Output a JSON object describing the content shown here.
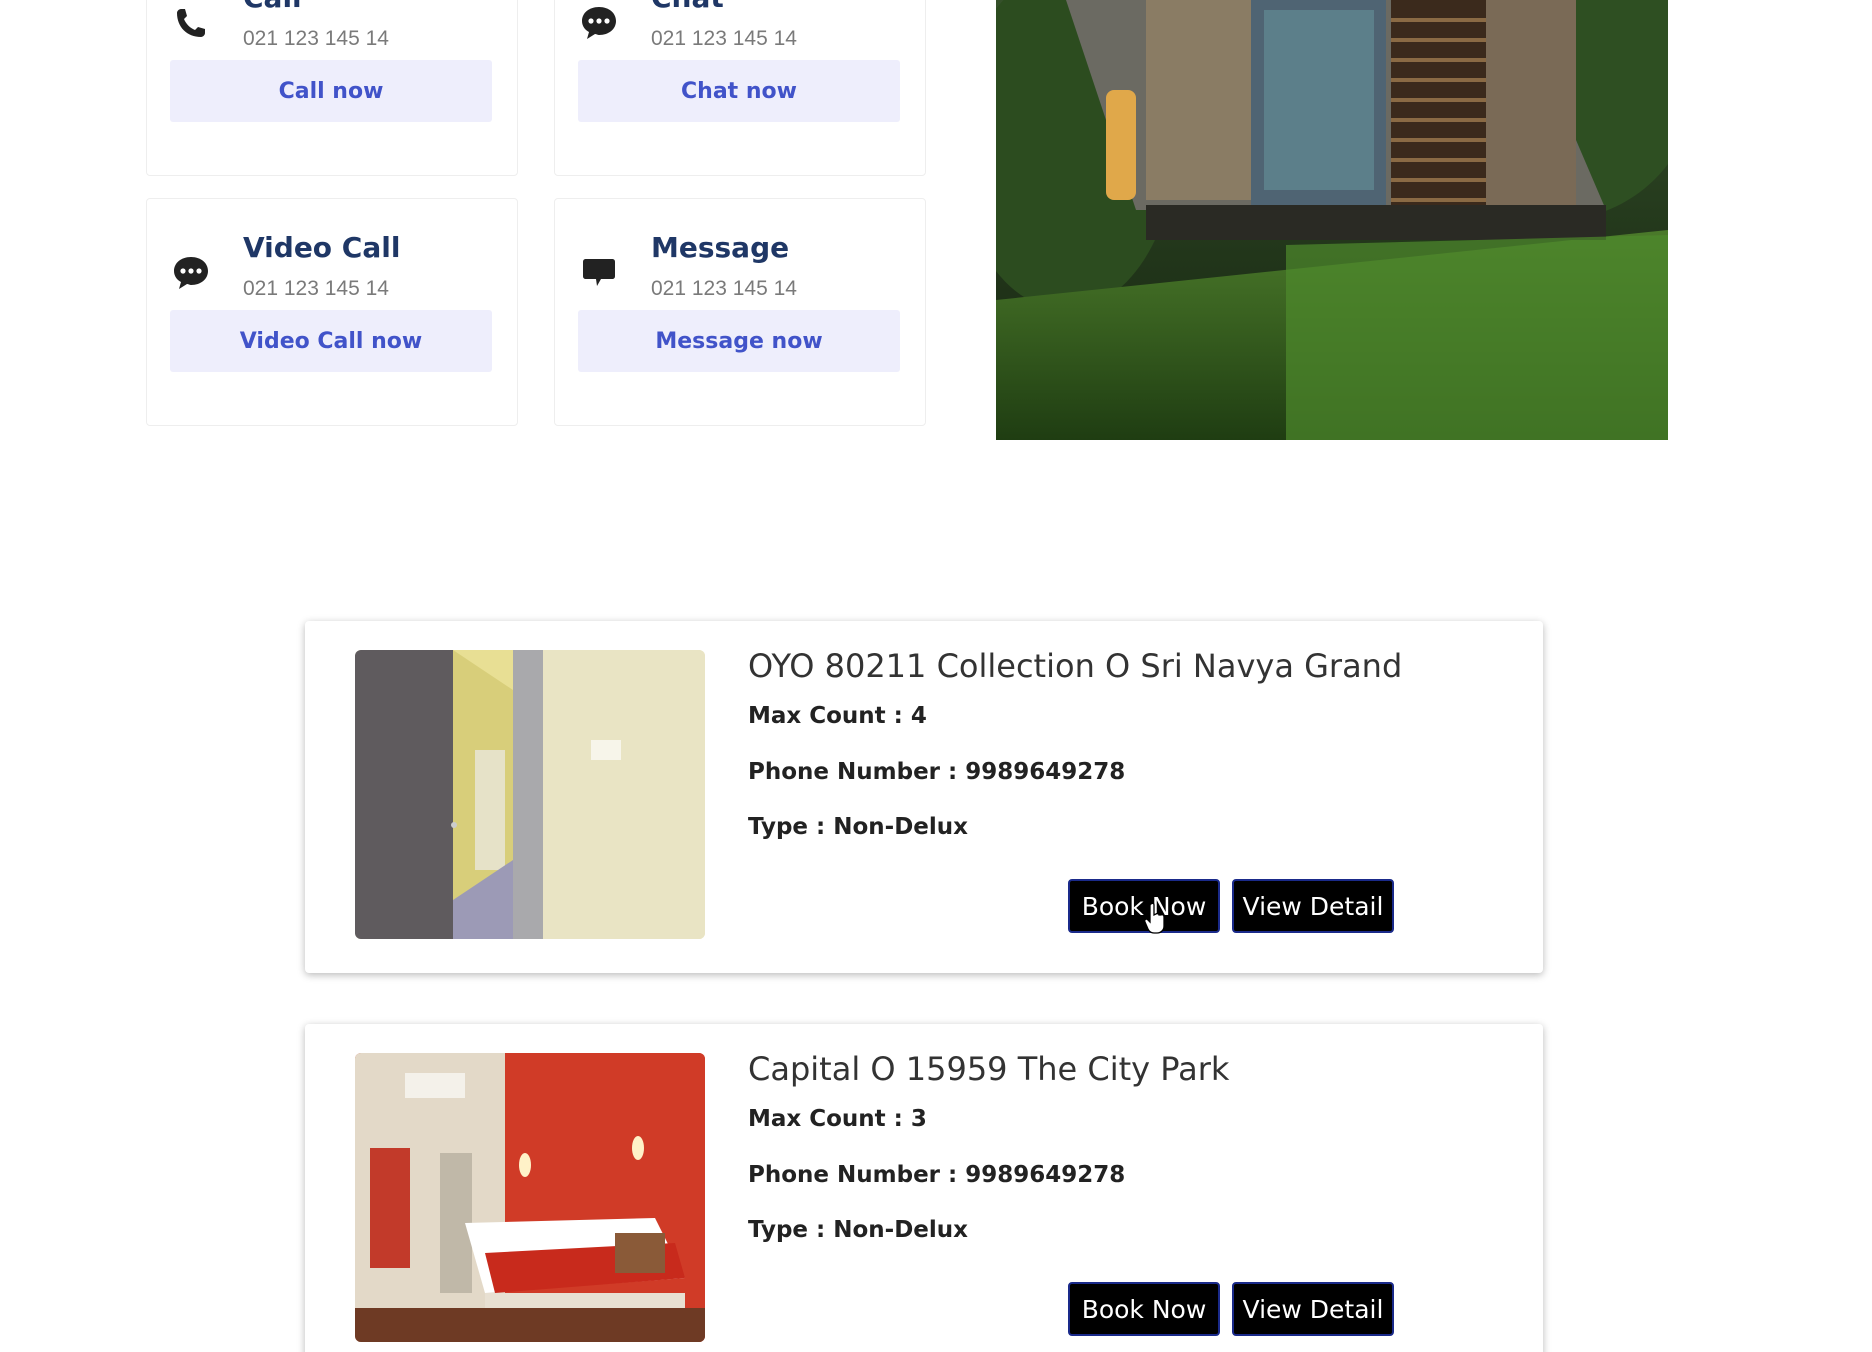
{
  "contacts": [
    {
      "title": "Call",
      "number": "021 123 145 14",
      "button": "Call now",
      "icon": "phone-icon"
    },
    {
      "title": "Chat",
      "number": "021 123 145 14",
      "button": "Chat now",
      "icon": "chat-bubble-dots-icon"
    },
    {
      "title": "Video Call",
      "number": "021 123 145 14",
      "button": "Video Call now",
      "icon": "chat-bubble-dots-icon"
    },
    {
      "title": "Message",
      "number": "021 123 145 14",
      "button": "Message now",
      "icon": "message-bubble-icon"
    }
  ],
  "hero": {
    "image": "modern-house-photo"
  },
  "hotels": [
    {
      "name": "OYO 80211 Collection O Sri Navya Grand",
      "max_count": "Max Count : 4",
      "phone": "Phone Number : 9989649278",
      "type": "Type : Non-Delux",
      "book_label": "Book Now",
      "view_label": "View Detail",
      "image": "hotel-corridor-photo"
    },
    {
      "name": "Capital O 15959 The City Park",
      "max_count": "Max Count : 3",
      "phone": "Phone Number : 9989649278",
      "type": "Type : Non-Delux",
      "book_label": "Book Now",
      "view_label": "View Detail",
      "image": "hotel-bedroom-photo"
    }
  ],
  "colors": {
    "contact_title": "#1f3766",
    "contact_button_bg": "#eeeefc",
    "contact_button_text": "#4153c9",
    "hotel_button_bg": "#000000"
  }
}
